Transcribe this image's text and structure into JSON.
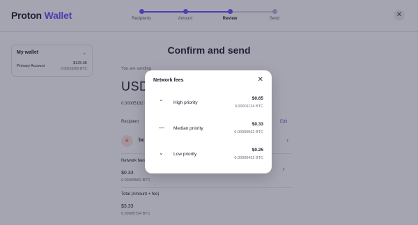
{
  "brand": {
    "name_part1": "Proton",
    "name_part2": "Wallet",
    "accent": "#6d4aff"
  },
  "stepper": {
    "steps": [
      {
        "label": "Recipients",
        "state": "done"
      },
      {
        "label": "Amount",
        "state": "done"
      },
      {
        "label": "Review",
        "state": "active"
      },
      {
        "label": "Send",
        "state": "pending"
      }
    ]
  },
  "wallet_selector": {
    "wallet_name": "My wallet",
    "account_name": "Primary Account",
    "balance_usd": "$125.05",
    "balance_btc": "0.00216269 BTC"
  },
  "main": {
    "title": "Confirm and send",
    "sending_label": "You are sending",
    "currency": "USD",
    "amount_btc": "0.00005162 BTC",
    "recipient_label": "Recipient",
    "edit_label": "Edit",
    "recipient_initial": "B",
    "recipient_address": "bc",
    "network_fee_label": "Network fees",
    "network_fee_usd": "$0.33",
    "network_fee_btc": "0.00000562 BTC",
    "total_label": "Total (Amount + fee)",
    "total_usd": "$3.33",
    "total_btc": "0.00005724 BTC"
  },
  "modal": {
    "title": "Network fees",
    "options": [
      {
        "icon": "chevron-up-icon",
        "name": "High priority",
        "usd": "$0.65",
        "btc": "0.00001124 BTC"
      },
      {
        "icon": "dash-icon",
        "name": "Median priority",
        "usd": "$0.33",
        "btc": "0.00000562 BTC"
      },
      {
        "icon": "chevron-down-icon",
        "name": "Low priority",
        "usd": "$0.25",
        "btc": "0.00000422 BTC"
      }
    ]
  }
}
